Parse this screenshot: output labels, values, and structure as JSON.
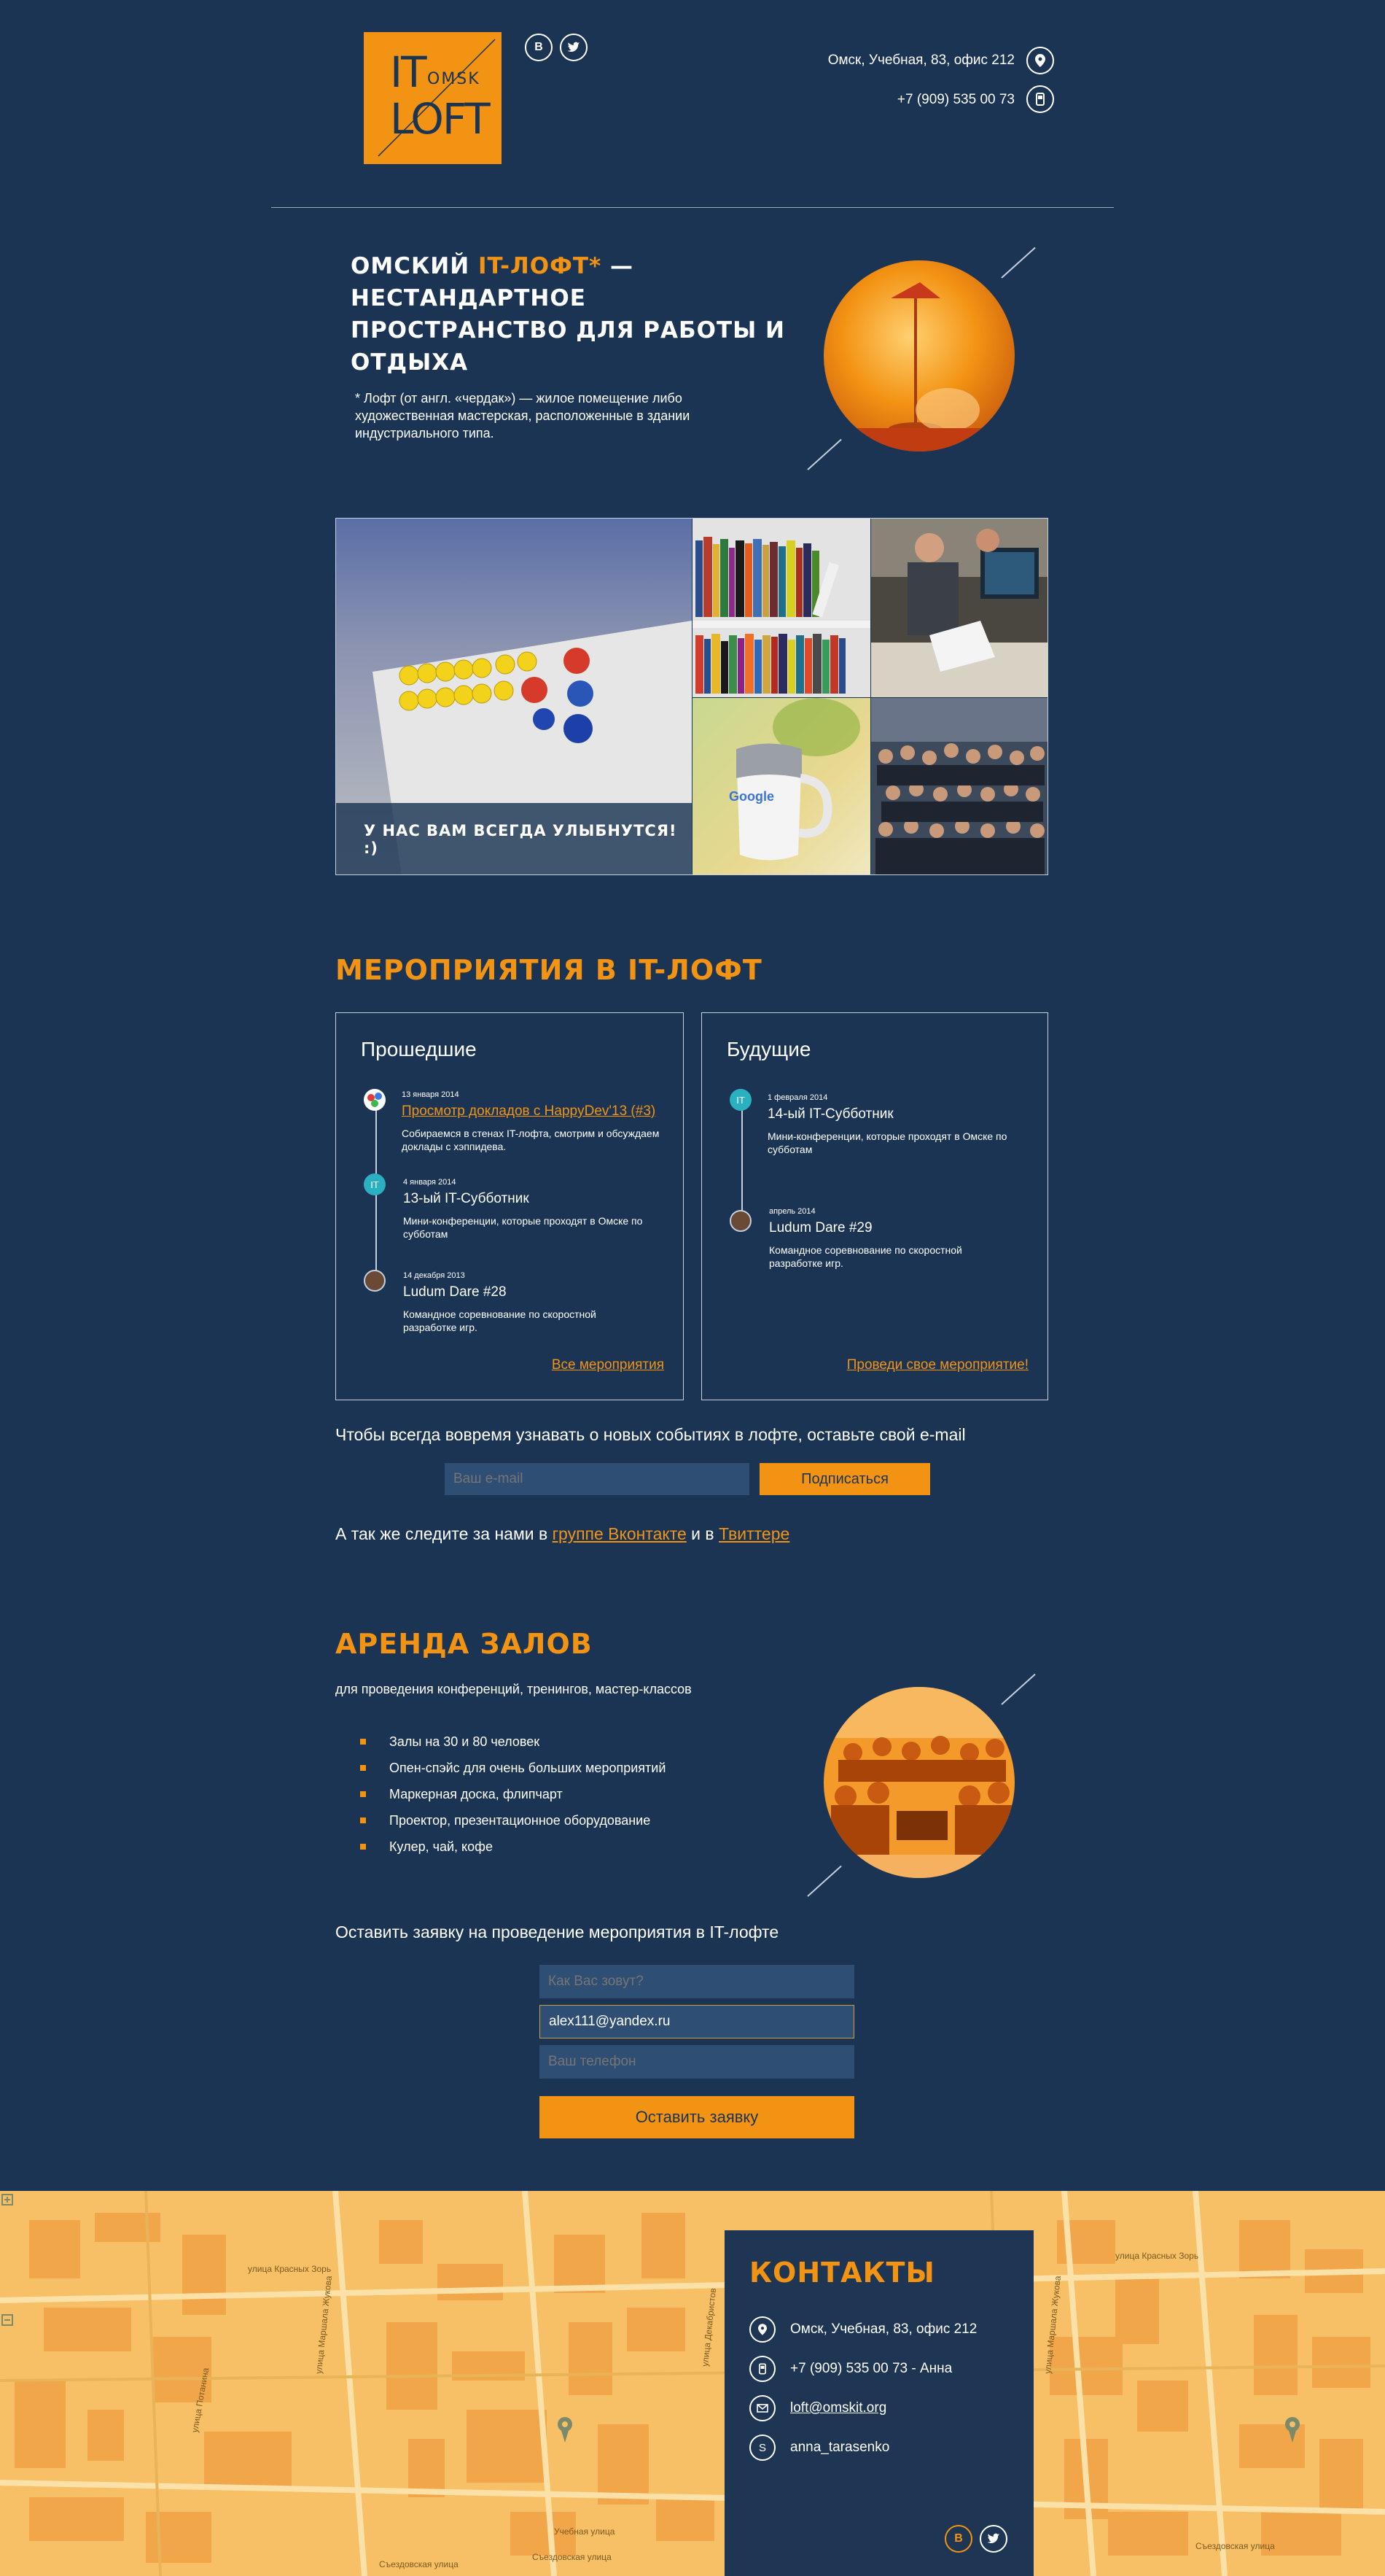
{
  "header": {
    "logo_it": "IT",
    "logo_loft": "LOFT",
    "logo_omsk": "OMSK",
    "social_vk": "В",
    "social_twitter_icon": "twitter-icon",
    "address": "Омск, Учебная, 83, офис 212",
    "phone": "+7 (909) 535 00 73"
  },
  "hero": {
    "title_a": "Омский ",
    "title_hl": "IT-лофт*",
    "title_b": " — нестандартное пространство для работы и отдыха",
    "note": "* Лофт (от англ. «чердак») — жилое помещение либо художественная мастерская, расположенные в здании индустриального типа."
  },
  "gallery": {
    "caption": "У нас вам всегда улыбнутся! :)",
    "mug_brand": "Google"
  },
  "events": {
    "heading": "Мероприятия в IT-лофт",
    "past": {
      "title": "Прошедшие",
      "items": [
        {
          "date": "13 января 2014",
          "title": "Просмотр докладов с HappyDev'13 (#3)",
          "desc": "Собираемся в стенах IT-лофта, смотрим и обсуждаем доклады с хэппидева."
        },
        {
          "date": "4 января 2014",
          "title": "13-ый IT-Субботник",
          "desc": "Мини-конференции, которые проходят в Омске по субботам"
        },
        {
          "date": "14 декабря 2013",
          "title": "Ludum Dare #28",
          "desc": "Командное соревнование по скоростной разработке игр."
        }
      ],
      "link": "Все мероприятия"
    },
    "future": {
      "title": "Будущие",
      "items": [
        {
          "date": "1 февраля 2014",
          "title": "14-ый IT-Субботник",
          "desc": "Мини-конференции, которые проходят в Омске по субботам"
        },
        {
          "date": "апрель 2014",
          "title": "Ludum Dare #29",
          "desc": "Командное соревнование по скоростной разработке игр."
        }
      ],
      "link": "Проведи свое мероприятие!"
    },
    "it_badge": "IT"
  },
  "subscribe": {
    "text": "Чтобы всегда вовремя узнавать о новых событиях в лофте, оставьте свой e-mail",
    "placeholder": "Ваш e-mail",
    "button": "Подписаться",
    "follow_a": "А так же следите за нами в ",
    "follow_vk": "группе Вконтакте",
    "follow_and": " и в ",
    "follow_tw": "Твиттере"
  },
  "rent": {
    "heading": "Аренда залов",
    "subtitle": "для проведения конференций, тренингов, мастер-классов",
    "bullets": [
      "Залы на 30 и 80 человек",
      "Опен-спэйс для очень больших мероприятий",
      "Маркерная доска, флипчарт",
      "Проектор, презентационное оборудование",
      "Кулер, чай, кофе"
    ],
    "form_title": "Оставить заявку на проведение мероприятия в IT-лофте",
    "name_placeholder": "Как Вас зовут?",
    "email_value": "alex111@yandex.ru",
    "phone_placeholder": "Ваш телефон",
    "button": "Оставить заявку"
  },
  "contacts": {
    "heading": "Контакты",
    "address": "Омск, Учебная, 83, офис 212",
    "phone": "+7 (909) 535 00 73 - Анна",
    "email": "loft@omskit.org",
    "skype": "anna_tarasenko",
    "social_vk": "В"
  },
  "map": {
    "streets": [
      "улица Красных Зорь",
      "улица Красных Зорь",
      "улица Маршала Жукова",
      "улица Маршала Жукова",
      "улица Декабристов",
      "Съездовская улица",
      "Съездовская улица",
      "Учебная улица",
      "улица Потанина",
      "Съездовская улица"
    ]
  },
  "colors": {
    "bg": "#1b3453",
    "accent": "#f39314",
    "map": "#f7c067"
  }
}
